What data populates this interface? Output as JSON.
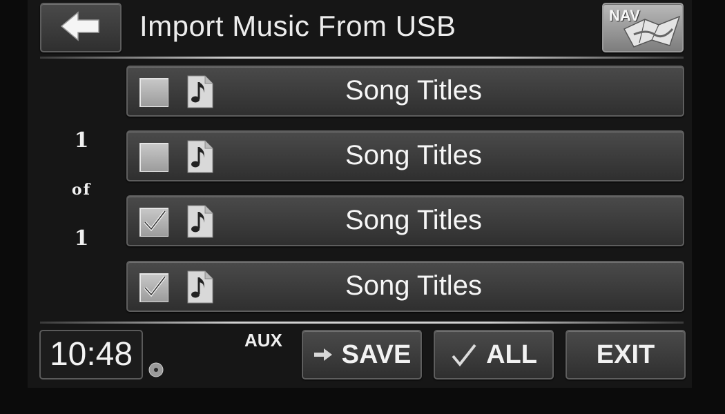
{
  "header": {
    "back_icon": "arrow-left-icon",
    "title": "Import Music From USB",
    "nav_label": "NAV",
    "nav_icon": "map-icon"
  },
  "pager": {
    "current": "1",
    "of": "of",
    "total": "1"
  },
  "songs": [
    {
      "title": "Song Titles",
      "checked": false,
      "icon": "music-file-icon"
    },
    {
      "title": "Song Titles",
      "checked": false,
      "icon": "music-file-icon"
    },
    {
      "title": "Song Titles",
      "checked": true,
      "icon": "music-file-icon"
    },
    {
      "title": "Song Titles",
      "checked": true,
      "icon": "music-file-icon"
    }
  ],
  "footer": {
    "clock": "10:48",
    "source": "AUX",
    "save_label": "SAVE",
    "all_label": "ALL",
    "exit_label": "EXIT",
    "disc_icon": "disc-icon"
  }
}
